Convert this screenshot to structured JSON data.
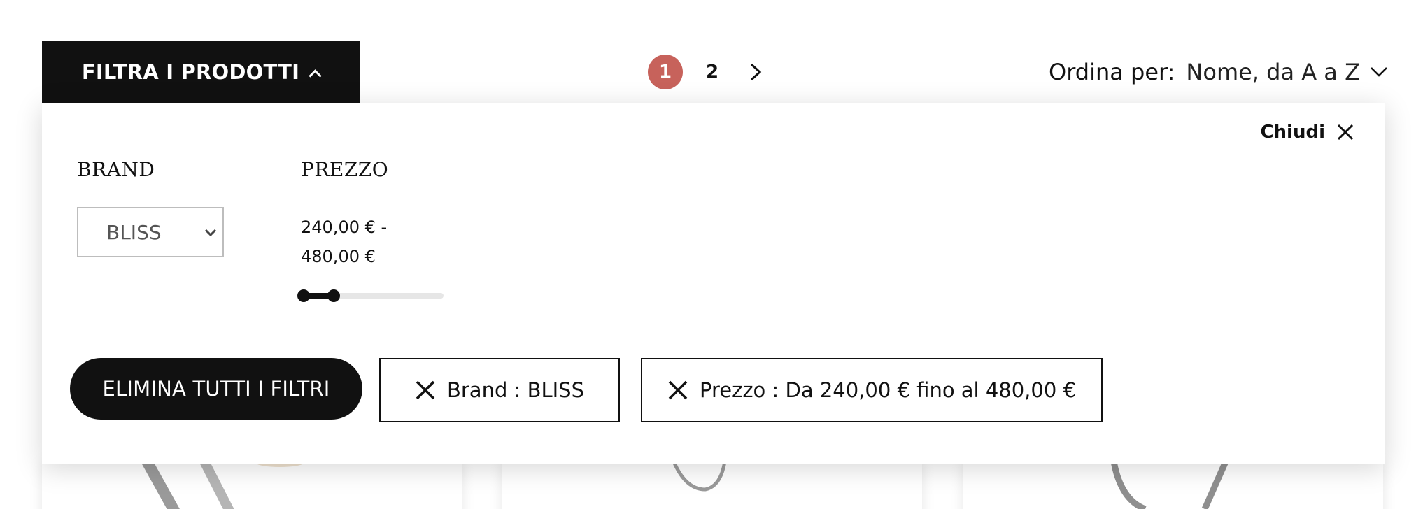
{
  "toolbar": {
    "filter_toggle_label": "FILTRA I PRODOTTI",
    "pagination": {
      "pages": [
        "1",
        "2"
      ],
      "current": "1"
    },
    "sort": {
      "label": "Ordina per:",
      "value": "Nome, da A a Z"
    }
  },
  "filter_panel": {
    "close_label": "Chiudi",
    "brand": {
      "title": "BRAND",
      "selected": "BLISS"
    },
    "price": {
      "title": "PREZZO",
      "range_line1": "240,00 € -",
      "range_line2": "480,00 €"
    },
    "clear_all_label": "ELIMINA TUTTI I FILTRI",
    "active_filters": [
      {
        "label": "Brand : BLISS"
      },
      {
        "label": "Prezzo : Da 240,00 € fino al 480,00 €"
      }
    ]
  },
  "colors": {
    "accent": "#c7625b",
    "dark": "#111111"
  },
  "icons": {
    "filter_toggle": "chevron-up-icon",
    "pager_next": "chevron-right-icon",
    "sort": "chevron-down-icon",
    "close": "close-icon",
    "chip_remove": "close-icon"
  }
}
